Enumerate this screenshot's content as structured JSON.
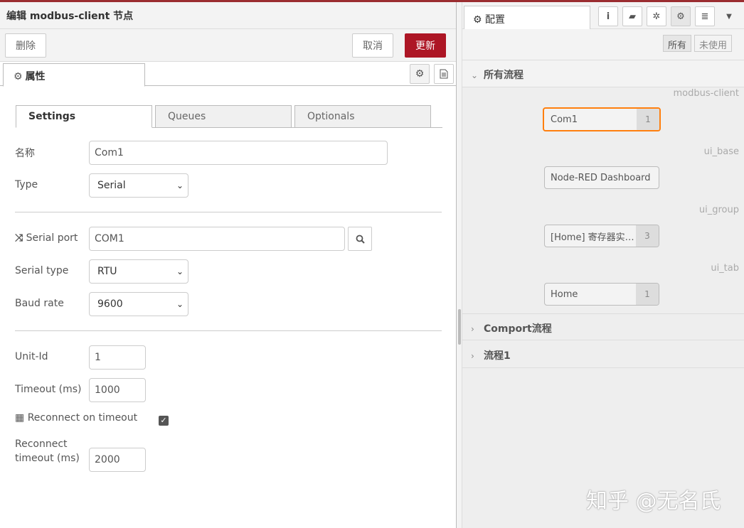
{
  "tray": {
    "title": "编辑 modbus-client 节点",
    "delete_label": "删除",
    "cancel_label": "取消",
    "update_label": "更新",
    "props_tab_label": "属性"
  },
  "form": {
    "tabs": [
      "Settings",
      "Queues",
      "Optionals"
    ],
    "name_label": "名称",
    "name_value": "Com1",
    "type_label": "Type",
    "type_value": "Serial",
    "serial_port_label": "Serial port",
    "serial_port_value": "COM1",
    "serial_type_label": "Serial type",
    "serial_type_value": "RTU",
    "baud_label": "Baud rate",
    "baud_value": "9600",
    "unit_id_label": "Unit-Id",
    "unit_id_value": "1",
    "timeout_label": "Timeout (ms)",
    "timeout_value": "1000",
    "reconnect_label": "Reconnect on timeout",
    "reconnect_checked": true,
    "reconnect_timeout_label_1": "Reconnect",
    "reconnect_timeout_label_2": "timeout (ms)",
    "reconnect_timeout_value": "2000"
  },
  "sidebar": {
    "tab_label": "配置",
    "filter_all": "所有",
    "filter_unused": "未使用",
    "sections": {
      "all_flows": "所有流程",
      "comport": "Comport流程",
      "flow1": "流程1"
    },
    "groups": [
      {
        "type": "modbus-client",
        "node": "Com1",
        "count": "1"
      },
      {
        "type": "ui_base",
        "node": "Node-RED Dashboard",
        "count": ""
      },
      {
        "type": "ui_group",
        "node": "[Home] 寄存器实…",
        "count": "3"
      },
      {
        "type": "ui_tab",
        "node": "Home",
        "count": "1"
      }
    ]
  },
  "watermark": "知乎 @无名氏",
  "colors": {
    "accent": "#ad1625",
    "selected_border": "#ff7f0e"
  }
}
